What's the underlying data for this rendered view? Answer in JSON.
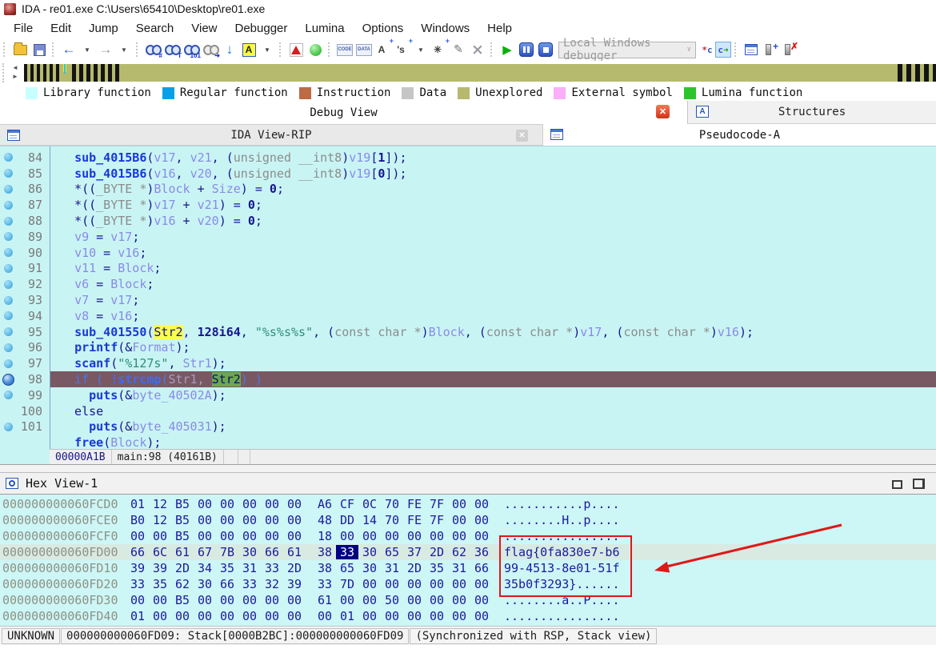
{
  "window": {
    "title": "IDA - re01.exe C:\\Users\\65410\\Desktop\\re01.exe"
  },
  "menu": {
    "items": [
      "File",
      "Edit",
      "Jump",
      "Search",
      "View",
      "Debugger",
      "Lumina",
      "Options",
      "Windows",
      "Help"
    ]
  },
  "toolbar": {
    "debugger_select": "Local Windows debugger"
  },
  "legend": {
    "items": [
      {
        "label": "Library function",
        "color": "#c8ffff"
      },
      {
        "label": "Regular function",
        "color": "#0aa0e8"
      },
      {
        "label": "Instruction",
        "color": "#bd6a45"
      },
      {
        "label": "Data",
        "color": "#c6c6c6"
      },
      {
        "label": "Unexplored",
        "color": "#b5ba6e"
      },
      {
        "label": "External symbol",
        "color": "#fcaef8"
      },
      {
        "label": "Lumina function",
        "color": "#2cc42c"
      }
    ]
  },
  "tabs": {
    "debug_view": "Debug View",
    "structures": "Structures",
    "ida_view": "IDA View-RIP",
    "pseudocode": "Pseudocode-A"
  },
  "pseudocode": {
    "lines": [
      {
        "n": "84",
        "m": "d",
        "s": [
          [
            "  ",
            "p"
          ],
          [
            "sub_4015B6",
            "c"
          ],
          [
            "(",
            "p"
          ],
          [
            "v17",
            "v"
          ],
          [
            ", ",
            "p"
          ],
          [
            "v21",
            "v"
          ],
          [
            ", (",
            "p"
          ],
          [
            "unsigned __int8",
            "k"
          ],
          [
            ")",
            "p"
          ],
          [
            "v19",
            "v"
          ],
          [
            "[",
            "p"
          ],
          [
            "1",
            "n"
          ],
          [
            "]);",
            "p"
          ]
        ]
      },
      {
        "n": "85",
        "m": "d",
        "s": [
          [
            "  ",
            "p"
          ],
          [
            "sub_4015B6",
            "c"
          ],
          [
            "(",
            "p"
          ],
          [
            "v16",
            "v"
          ],
          [
            ", ",
            "p"
          ],
          [
            "v20",
            "v"
          ],
          [
            ", (",
            "p"
          ],
          [
            "unsigned __int8",
            "k"
          ],
          [
            ")",
            "p"
          ],
          [
            "v19",
            "v"
          ],
          [
            "[",
            "p"
          ],
          [
            "0",
            "n"
          ],
          [
            "]);",
            "p"
          ]
        ]
      },
      {
        "n": "86",
        "m": "d",
        "s": [
          [
            "  *((",
            "p"
          ],
          [
            "_BYTE *",
            "k"
          ],
          [
            ")",
            "p"
          ],
          [
            "Block",
            "v"
          ],
          [
            " + ",
            "p"
          ],
          [
            "Size",
            "v"
          ],
          [
            ") = ",
            "p"
          ],
          [
            "0",
            "n"
          ],
          [
            ";",
            "p"
          ]
        ]
      },
      {
        "n": "87",
        "m": "d",
        "s": [
          [
            "  *((",
            "p"
          ],
          [
            "_BYTE *",
            "k"
          ],
          [
            ")",
            "p"
          ],
          [
            "v17",
            "v"
          ],
          [
            " + ",
            "p"
          ],
          [
            "v21",
            "v"
          ],
          [
            ") = ",
            "p"
          ],
          [
            "0",
            "n"
          ],
          [
            ";",
            "p"
          ]
        ]
      },
      {
        "n": "88",
        "m": "d",
        "s": [
          [
            "  *((",
            "p"
          ],
          [
            "_BYTE *",
            "k"
          ],
          [
            ")",
            "p"
          ],
          [
            "v16",
            "v"
          ],
          [
            " + ",
            "p"
          ],
          [
            "v20",
            "v"
          ],
          [
            ") = ",
            "p"
          ],
          [
            "0",
            "n"
          ],
          [
            ";",
            "p"
          ]
        ]
      },
      {
        "n": "89",
        "m": "d",
        "s": [
          [
            "  ",
            "p"
          ],
          [
            "v9",
            "v"
          ],
          [
            " = ",
            "p"
          ],
          [
            "v17",
            "v"
          ],
          [
            ";",
            "p"
          ]
        ]
      },
      {
        "n": "90",
        "m": "d",
        "s": [
          [
            "  ",
            "p"
          ],
          [
            "v10",
            "v"
          ],
          [
            " = ",
            "p"
          ],
          [
            "v16",
            "v"
          ],
          [
            ";",
            "p"
          ]
        ]
      },
      {
        "n": "91",
        "m": "d",
        "s": [
          [
            "  ",
            "p"
          ],
          [
            "v11",
            "v"
          ],
          [
            " = ",
            "p"
          ],
          [
            "Block",
            "v"
          ],
          [
            ";",
            "p"
          ]
        ]
      },
      {
        "n": "92",
        "m": "d",
        "s": [
          [
            "  ",
            "p"
          ],
          [
            "v6",
            "v"
          ],
          [
            " = ",
            "p"
          ],
          [
            "Block",
            "v"
          ],
          [
            ";",
            "p"
          ]
        ]
      },
      {
        "n": "93",
        "m": "d",
        "s": [
          [
            "  ",
            "p"
          ],
          [
            "v7",
            "v"
          ],
          [
            " = ",
            "p"
          ],
          [
            "v17",
            "v"
          ],
          [
            ";",
            "p"
          ]
        ]
      },
      {
        "n": "94",
        "m": "d",
        "s": [
          [
            "  ",
            "p"
          ],
          [
            "v8",
            "v"
          ],
          [
            " = ",
            "p"
          ],
          [
            "v16",
            "v"
          ],
          [
            ";",
            "p"
          ]
        ]
      },
      {
        "n": "95",
        "m": "d",
        "s": [
          [
            "  ",
            "p"
          ],
          [
            "sub_401550",
            "c"
          ],
          [
            "(",
            "p"
          ],
          [
            "Str2",
            "y"
          ],
          [
            ", ",
            "p"
          ],
          [
            "128i64",
            "n"
          ],
          [
            ", ",
            "p"
          ],
          [
            "\"%s%s%s\"",
            "s"
          ],
          [
            ", (",
            "p"
          ],
          [
            "const char *",
            "k"
          ],
          [
            ")",
            "p"
          ],
          [
            "Block",
            "v"
          ],
          [
            ", (",
            "p"
          ],
          [
            "const char *",
            "k"
          ],
          [
            ")",
            "p"
          ],
          [
            "v17",
            "v"
          ],
          [
            ", (",
            "p"
          ],
          [
            "const char *",
            "k"
          ],
          [
            ")",
            "p"
          ],
          [
            "v16",
            "v"
          ],
          [
            ");",
            "p"
          ]
        ]
      },
      {
        "n": "96",
        "m": "d",
        "s": [
          [
            "  ",
            "p"
          ],
          [
            "printf",
            "c"
          ],
          [
            "(&",
            "p"
          ],
          [
            "Format",
            "v"
          ],
          [
            ");",
            "p"
          ]
        ]
      },
      {
        "n": "97",
        "m": "d",
        "s": [
          [
            "  ",
            "p"
          ],
          [
            "scanf",
            "c"
          ],
          [
            "(",
            "p"
          ],
          [
            "\"%127s\"",
            "s"
          ],
          [
            ", ",
            "p"
          ],
          [
            "Str1",
            "v"
          ],
          [
            ");",
            "p"
          ]
        ]
      },
      {
        "n": "98",
        "m": "r",
        "cur": true,
        "s": [
          [
            "  if ( ",
            "db"
          ],
          [
            "!strcmp",
            "dc"
          ],
          [
            "(",
            "db"
          ],
          [
            "Str1",
            "dv"
          ],
          [
            ", ",
            "dv"
          ],
          [
            "Str2",
            "dg"
          ],
          [
            ") )",
            "db"
          ]
        ]
      },
      {
        "n": "99",
        "m": "d",
        "s": [
          [
            "    ",
            "p"
          ],
          [
            "puts",
            "c"
          ],
          [
            "(&",
            "p"
          ],
          [
            "byte_40502A",
            "v"
          ],
          [
            ");",
            "p"
          ]
        ]
      },
      {
        "n": "100",
        "m": "",
        "s": [
          [
            "  else",
            "p"
          ]
        ]
      },
      {
        "n": "101",
        "m": "d",
        "s": [
          [
            "    ",
            "p"
          ],
          [
            "puts",
            "c"
          ],
          [
            "(&",
            "p"
          ],
          [
            "byte_405031",
            "v"
          ],
          [
            ");",
            "p"
          ]
        ]
      },
      {
        "n": "",
        "m": "",
        "s": [
          [
            "  ",
            "p"
          ],
          [
            "free",
            "c"
          ],
          [
            "(",
            "p"
          ],
          [
            "Block",
            "v"
          ],
          [
            ");",
            "p"
          ]
        ]
      }
    ],
    "footer": {
      "addr": "00000A1B",
      "loc": "main:98 (40161B)"
    }
  },
  "hexview": {
    "title": "Hex View-1",
    "sel": {
      "row": 3,
      "col": 9
    },
    "rows": [
      {
        "addr": "000000000060FCD0",
        "bytes": [
          "01",
          "12",
          "B5",
          "00",
          "00",
          "00",
          "00",
          "00",
          "A6",
          "CF",
          "0C",
          "70",
          "FE",
          "7F",
          "00",
          "00"
        ],
        "ascii": "...........p...."
      },
      {
        "addr": "000000000060FCE0",
        "bytes": [
          "B0",
          "12",
          "B5",
          "00",
          "00",
          "00",
          "00",
          "00",
          "48",
          "DD",
          "14",
          "70",
          "FE",
          "7F",
          "00",
          "00"
        ],
        "ascii": "........H..p...."
      },
      {
        "addr": "000000000060FCF0",
        "bytes": [
          "00",
          "00",
          "B5",
          "00",
          "00",
          "00",
          "00",
          "00",
          "18",
          "00",
          "00",
          "00",
          "00",
          "00",
          "00",
          "00"
        ],
        "ascii": "................"
      },
      {
        "addr": "000000000060FD00",
        "bytes": [
          "66",
          "6C",
          "61",
          "67",
          "7B",
          "30",
          "66",
          "61",
          "38",
          "33",
          "30",
          "65",
          "37",
          "2D",
          "62",
          "36"
        ],
        "ascii": "flag{0fa830e7-b6"
      },
      {
        "addr": "000000000060FD10",
        "bytes": [
          "39",
          "39",
          "2D",
          "34",
          "35",
          "31",
          "33",
          "2D",
          "38",
          "65",
          "30",
          "31",
          "2D",
          "35",
          "31",
          "66"
        ],
        "ascii": "99-4513-8e01-51f"
      },
      {
        "addr": "000000000060FD20",
        "bytes": [
          "33",
          "35",
          "62",
          "30",
          "66",
          "33",
          "32",
          "39",
          "33",
          "7D",
          "00",
          "00",
          "00",
          "00",
          "00",
          "00"
        ],
        "ascii": "35b0f3293}......"
      },
      {
        "addr": "000000000060FD30",
        "bytes": [
          "00",
          "00",
          "B5",
          "00",
          "00",
          "00",
          "00",
          "00",
          "61",
          "00",
          "00",
          "50",
          "00",
          "00",
          "00",
          "00"
        ],
        "ascii": "........a..P...."
      },
      {
        "addr": "000000000060FD40",
        "bytes": [
          "01",
          "00",
          "00",
          "00",
          "00",
          "00",
          "00",
          "00",
          "00",
          "01",
          "00",
          "00",
          "00",
          "00",
          "00",
          "00"
        ],
        "ascii": "................"
      }
    ]
  },
  "statusbar": {
    "state": "UNKNOWN",
    "location": "000000000060FD09: Stack[0000B2BC]:000000000060FD09",
    "sync": "(Synchronized with RSP, Stack view)"
  }
}
